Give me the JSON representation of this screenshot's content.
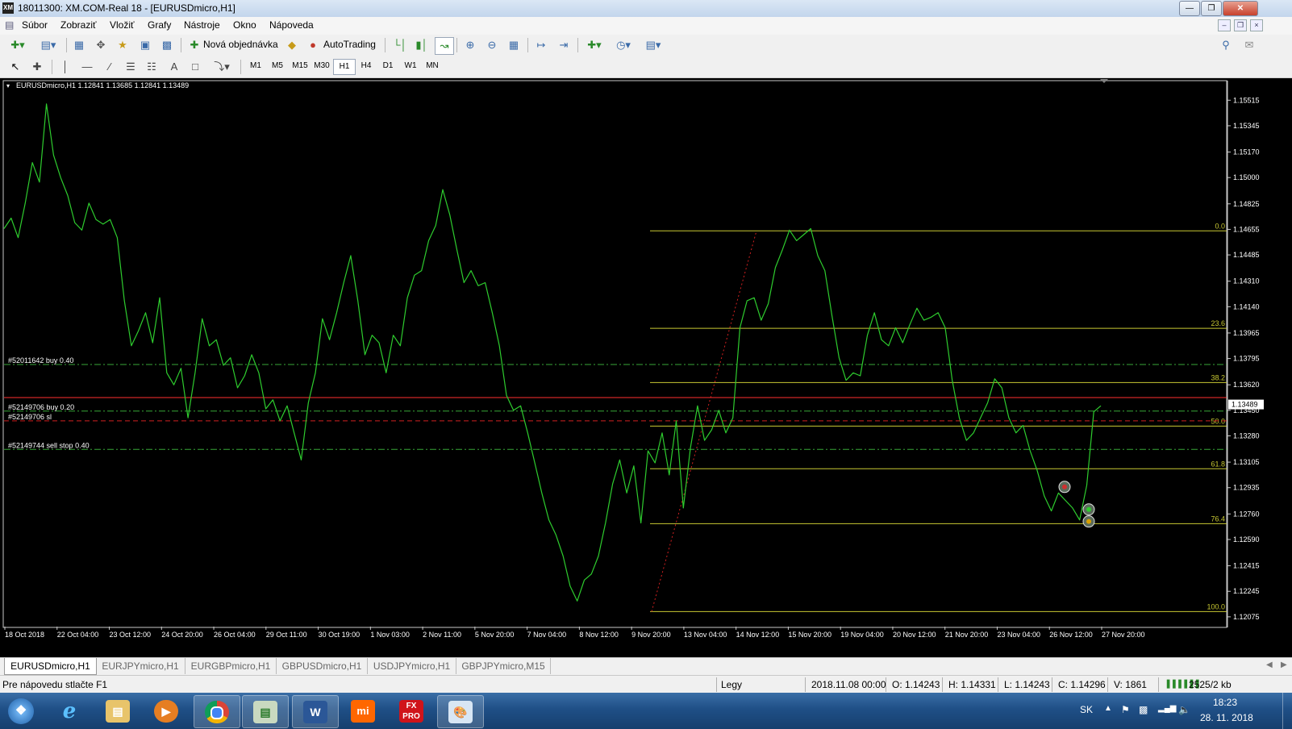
{
  "window": {
    "title": "18011300: XM.COM-Real 18 - [EURUSDmicro,H1]",
    "app_icon": "XM"
  },
  "menu": [
    "Súbor",
    "Zobraziť",
    "Vložiť",
    "Grafy",
    "Nástroje",
    "Okno",
    "Nápoveda"
  ],
  "toolbar": {
    "new_order_label": "Nová objednávka",
    "autotrading_label": "AutoTrading"
  },
  "timeframes": [
    "M1",
    "M5",
    "M15",
    "M30",
    "H1",
    "H4",
    "D1",
    "W1",
    "MN"
  ],
  "active_timeframe": "H1",
  "chart": {
    "header": "EURUSDmicro,H1  1.12841 1.13685 1.12841 1.13489",
    "current_price": "1.13489",
    "colors": {
      "price_line": "#2ecc2e",
      "fib": "#c8c832",
      "order": "#37a637",
      "sl": "#d02020",
      "bid": "#ff3030"
    },
    "orders": [
      {
        "label": "#52011642 buy 0.40"
      },
      {
        "label": "#52149706 buy 0.20"
      },
      {
        "label": "#52149706 sl"
      },
      {
        "label": "#52149744 sell stop 0.40"
      }
    ]
  },
  "chart_data": {
    "type": "line",
    "symbol": "EURUSDmicro",
    "timeframe": "H1",
    "y_ticks": [
      "1.15515",
      "1.15345",
      "1.15170",
      "1.15000",
      "1.14825",
      "1.14655",
      "1.14485",
      "1.14310",
      "1.14140",
      "1.13965",
      "1.13795",
      "1.13620",
      "1.13450",
      "1.13280",
      "1.13105",
      "1.12935",
      "1.12760",
      "1.12590",
      "1.12415",
      "1.12245",
      "1.12075"
    ],
    "ylim": [
      1.1201,
      1.1564
    ],
    "x_ticks": [
      "18 Oct 2018",
      "22 Oct 04:00",
      "23 Oct 12:00",
      "24 Oct 20:00",
      "26 Oct 04:00",
      "29 Oct 11:00",
      "30 Oct 19:00",
      "1 Nov 03:00",
      "2 Nov 11:00",
      "5 Nov 20:00",
      "7 Nov 04:00",
      "8 Nov 12:00",
      "9 Nov 20:00",
      "13 Nov 04:00",
      "14 Nov 12:00",
      "15 Nov 20:00",
      "19 Nov 04:00",
      "20 Nov 12:00",
      "21 Nov 20:00",
      "23 Nov 04:00",
      "26 Nov 12:00",
      "27 Nov 20:00"
    ],
    "price_path": [
      [
        0,
        1.1466
      ],
      [
        1,
        1.1473
      ],
      [
        2,
        1.146
      ],
      [
        3,
        1.1483
      ],
      [
        4,
        1.151
      ],
      [
        5,
        1.1497
      ],
      [
        6,
        1.1549
      ],
      [
        7,
        1.1515
      ],
      [
        8,
        1.15
      ],
      [
        9,
        1.1488
      ],
      [
        10,
        1.147
      ],
      [
        11,
        1.1465
      ],
      [
        12,
        1.1483
      ],
      [
        13,
        1.1472
      ],
      [
        14,
        1.1469
      ],
      [
        15,
        1.1472
      ],
      [
        16,
        1.146
      ],
      [
        17,
        1.1418
      ],
      [
        18,
        1.1388
      ],
      [
        19,
        1.1398
      ],
      [
        20,
        1.141
      ],
      [
        21,
        1.139
      ],
      [
        22,
        1.142
      ],
      [
        23,
        1.137
      ],
      [
        24,
        1.1362
      ],
      [
        25,
        1.1373
      ],
      [
        26,
        1.134
      ],
      [
        27,
        1.137
      ],
      [
        28,
        1.1406
      ],
      [
        29,
        1.1388
      ],
      [
        30,
        1.1392
      ],
      [
        31,
        1.1375
      ],
      [
        32,
        1.138
      ],
      [
        33,
        1.136
      ],
      [
        34,
        1.1368
      ],
      [
        35,
        1.1382
      ],
      [
        36,
        1.137
      ],
      [
        37,
        1.1346
      ],
      [
        38,
        1.1352
      ],
      [
        39,
        1.1338
      ],
      [
        40,
        1.1348
      ],
      [
        41,
        1.133
      ],
      [
        42,
        1.1312
      ],
      [
        43,
        1.135
      ],
      [
        44,
        1.137
      ],
      [
        45,
        1.1406
      ],
      [
        46,
        1.1392
      ],
      [
        47,
        1.141
      ],
      [
        48,
        1.143
      ],
      [
        49,
        1.1448
      ],
      [
        50,
        1.1418
      ],
      [
        51,
        1.1382
      ],
      [
        52,
        1.1395
      ],
      [
        53,
        1.139
      ],
      [
        54,
        1.137
      ],
      [
        55,
        1.1395
      ],
      [
        56,
        1.1388
      ],
      [
        57,
        1.142
      ],
      [
        58,
        1.1435
      ],
      [
        59,
        1.1438
      ],
      [
        60,
        1.1458
      ],
      [
        61,
        1.1468
      ],
      [
        62,
        1.1492
      ],
      [
        63,
        1.1475
      ],
      [
        64,
        1.1452
      ],
      [
        65,
        1.143
      ],
      [
        66,
        1.1438
      ],
      [
        67,
        1.1428
      ],
      [
        68,
        1.143
      ],
      [
        69,
        1.141
      ],
      [
        70,
        1.1388
      ],
      [
        71,
        1.1355
      ],
      [
        72,
        1.1345
      ],
      [
        73,
        1.1348
      ],
      [
        74,
        1.133
      ],
      [
        75,
        1.131
      ],
      [
        76,
        1.129
      ],
      [
        77,
        1.1272
      ],
      [
        78,
        1.1262
      ],
      [
        79,
        1.1248
      ],
      [
        80,
        1.1228
      ],
      [
        81,
        1.1218
      ],
      [
        82,
        1.1232
      ],
      [
        83,
        1.1236
      ],
      [
        84,
        1.1248
      ],
      [
        85,
        1.127
      ],
      [
        86,
        1.1296
      ],
      [
        87,
        1.1312
      ],
      [
        88,
        1.129
      ],
      [
        89,
        1.1308
      ],
      [
        90,
        1.127
      ],
      [
        91,
        1.1318
      ],
      [
        92,
        1.131
      ],
      [
        93,
        1.133
      ],
      [
        94,
        1.1302
      ],
      [
        95,
        1.1338
      ],
      [
        96,
        1.128
      ],
      [
        97,
        1.132
      ],
      [
        98,
        1.1348
      ],
      [
        99,
        1.1325
      ],
      [
        100,
        1.1332
      ],
      [
        101,
        1.1345
      ],
      [
        102,
        1.133
      ],
      [
        103,
        1.134
      ],
      [
        104,
        1.14
      ],
      [
        105,
        1.1418
      ],
      [
        106,
        1.142
      ],
      [
        107,
        1.1405
      ],
      [
        108,
        1.1416
      ],
      [
        109,
        1.144
      ],
      [
        110,
        1.1452
      ],
      [
        111,
        1.1465
      ],
      [
        112,
        1.1458
      ],
      [
        113,
        1.1462
      ],
      [
        114,
        1.1466
      ],
      [
        115,
        1.1448
      ],
      [
        116,
        1.1438
      ],
      [
        117,
        1.1408
      ],
      [
        118,
        1.138
      ],
      [
        119,
        1.1365
      ],
      [
        120,
        1.137
      ],
      [
        121,
        1.1368
      ],
      [
        122,
        1.1395
      ],
      [
        123,
        1.141
      ],
      [
        124,
        1.1392
      ],
      [
        125,
        1.1388
      ],
      [
        126,
        1.14
      ],
      [
        127,
        1.139
      ],
      [
        128,
        1.1402
      ],
      [
        129,
        1.1413
      ],
      [
        130,
        1.1405
      ],
      [
        131,
        1.1407
      ],
      [
        132,
        1.141
      ],
      [
        133,
        1.14
      ],
      [
        134,
        1.1365
      ],
      [
        135,
        1.134
      ],
      [
        136,
        1.1325
      ],
      [
        137,
        1.133
      ],
      [
        138,
        1.134
      ],
      [
        139,
        1.135
      ],
      [
        140,
        1.1366
      ],
      [
        141,
        1.136
      ],
      [
        142,
        1.134
      ],
      [
        143,
        1.133
      ],
      [
        144,
        1.1335
      ],
      [
        145,
        1.1318
      ],
      [
        146,
        1.1305
      ],
      [
        147,
        1.1288
      ],
      [
        148,
        1.1278
      ],
      [
        149,
        1.129
      ],
      [
        150,
        1.1285
      ],
      [
        151,
        1.128
      ],
      [
        152,
        1.1272
      ],
      [
        153,
        1.1295
      ],
      [
        154,
        1.1344
      ],
      [
        155,
        1.1348
      ]
    ],
    "fibonacci": [
      {
        "level": "0.0",
        "price": 1.14645
      },
      {
        "level": "23.6",
        "price": 1.13996
      },
      {
        "level": "38.2",
        "price": 1.13635
      },
      {
        "level": "50.0",
        "price": 1.13345
      },
      {
        "level": "61.8",
        "price": 1.13061
      },
      {
        "level": "76.4",
        "price": 1.12695
      },
      {
        "level": "100.0",
        "price": 1.1211
      }
    ],
    "order_lines": [
      {
        "label": "#52011642 buy 0.40",
        "price": 1.13755,
        "color": "#37a637",
        "style": "dash-dot"
      },
      {
        "label": "#52149706 buy 0.20",
        "price": 1.13445,
        "color": "#37a637",
        "style": "dash-dot"
      },
      {
        "label": "#52149706 sl",
        "price": 1.1338,
        "color": "#d02020",
        "style": "dash"
      },
      {
        "label": "#52149744 sell stop 0.40",
        "price": 1.1319,
        "color": "#37a637",
        "style": "dash-dot"
      }
    ],
    "bid_price": 1.13535,
    "grid": false,
    "legend": "none"
  },
  "chart_tabs": [
    "EURUSDmicro,H1",
    "EURJPYmicro,H1",
    "EURGBPmicro,H1",
    "GBPUSDmicro,H1",
    "USDJPYmicro,H1",
    "GBPJPYmicro,M15"
  ],
  "active_chart_tab": "EURUSDmicro,H1",
  "status": {
    "help": "Pre nápovedu stlačte F1",
    "profile": "Legy",
    "datetime": "2018.11.08 00:00",
    "open": "O: 1.14243",
    "high": "H: 1.14331",
    "low": "L: 1.14243",
    "close": "C: 1.14296",
    "volume": "V: 1861",
    "traffic": "2525/2 kb"
  },
  "taskbar": {
    "lang": "SK",
    "time": "18:23",
    "date": "28. 11. 2018",
    "apps": [
      "start",
      "internet-explorer",
      "file-explorer",
      "media-player",
      "chrome",
      "metatrader",
      "word",
      "mi",
      "fxpro",
      "paint"
    ]
  }
}
